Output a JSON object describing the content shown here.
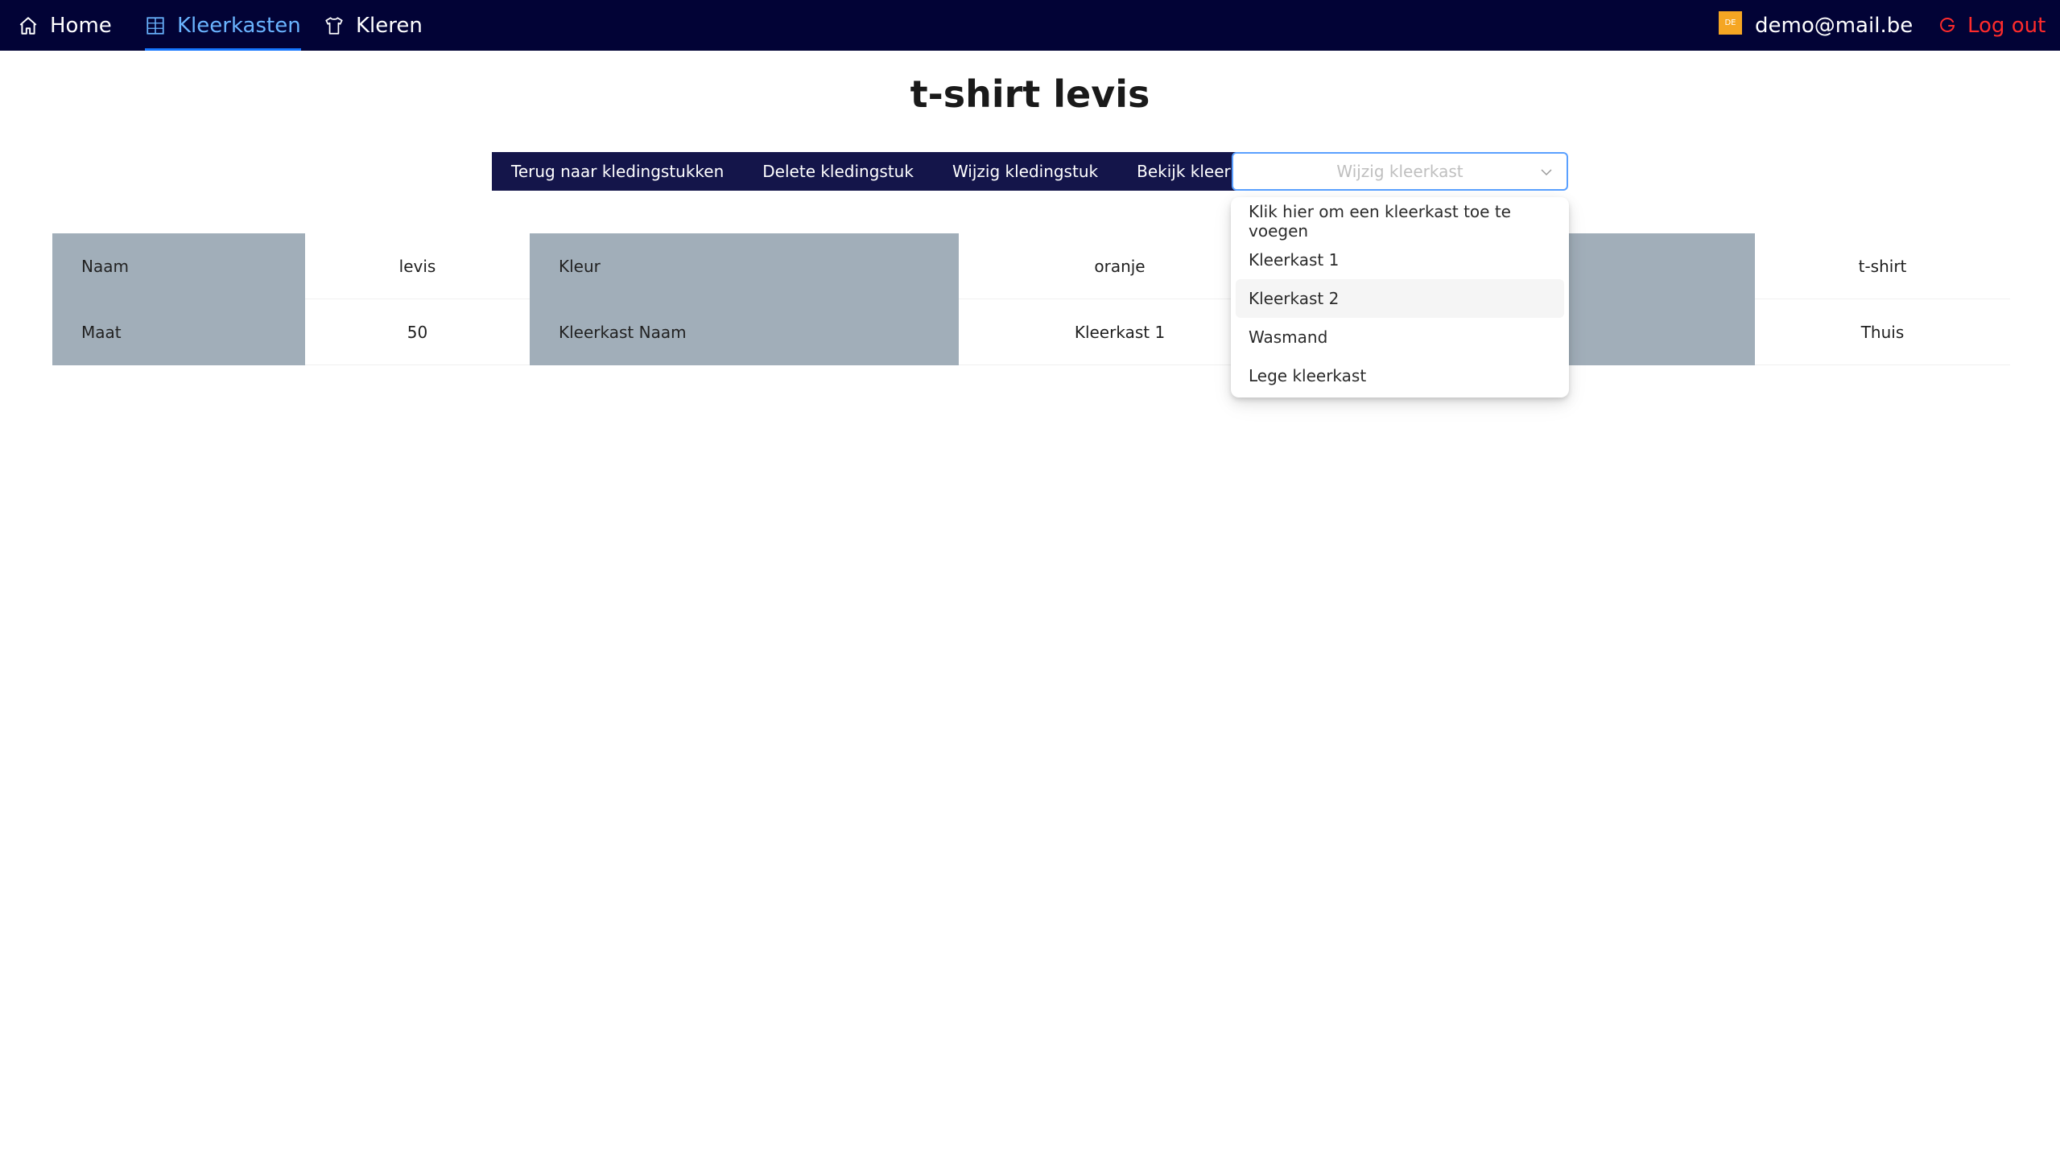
{
  "nav": {
    "home": "Home",
    "kleerkasten": "Kleerkasten",
    "kleren": "Kleren"
  },
  "user": {
    "avatar_initials": "DE",
    "email": "demo@mail.be",
    "logout": "Log out"
  },
  "page": {
    "title": "t-shirt levis"
  },
  "toolbar": {
    "back": "Terug naar kledingstukken",
    "delete": "Delete kledingstuk",
    "edit": "Wijzig kledingstuk",
    "view_closet": "Bekijk kleerkast",
    "select_placeholder": "Wijzig kleerkast"
  },
  "details": {
    "row1": {
      "label1": "Naam",
      "value1": "levis",
      "label2": "Kleur",
      "value2": "oranje",
      "value3": "t-shirt"
    },
    "row2": {
      "label1": "Maat",
      "value1": "50",
      "label2": "Kleerkast Naam",
      "value2": "Kleerkast 1",
      "value3": "Thuis"
    }
  },
  "dropdown": {
    "options": [
      "Klik hier om een kleerkast toe te voegen",
      "Kleerkast 1",
      "Kleerkast 2",
      "Wasmand",
      "Lege kleerkast"
    ]
  },
  "colors": {
    "nav_bg": "#020336",
    "active_nav": "#6ab4ff",
    "toolbar_bg": "#14154a",
    "label_cell_bg": "#a1aeb9",
    "logout": "#ff2b2b",
    "avatar": "#f5a623"
  }
}
